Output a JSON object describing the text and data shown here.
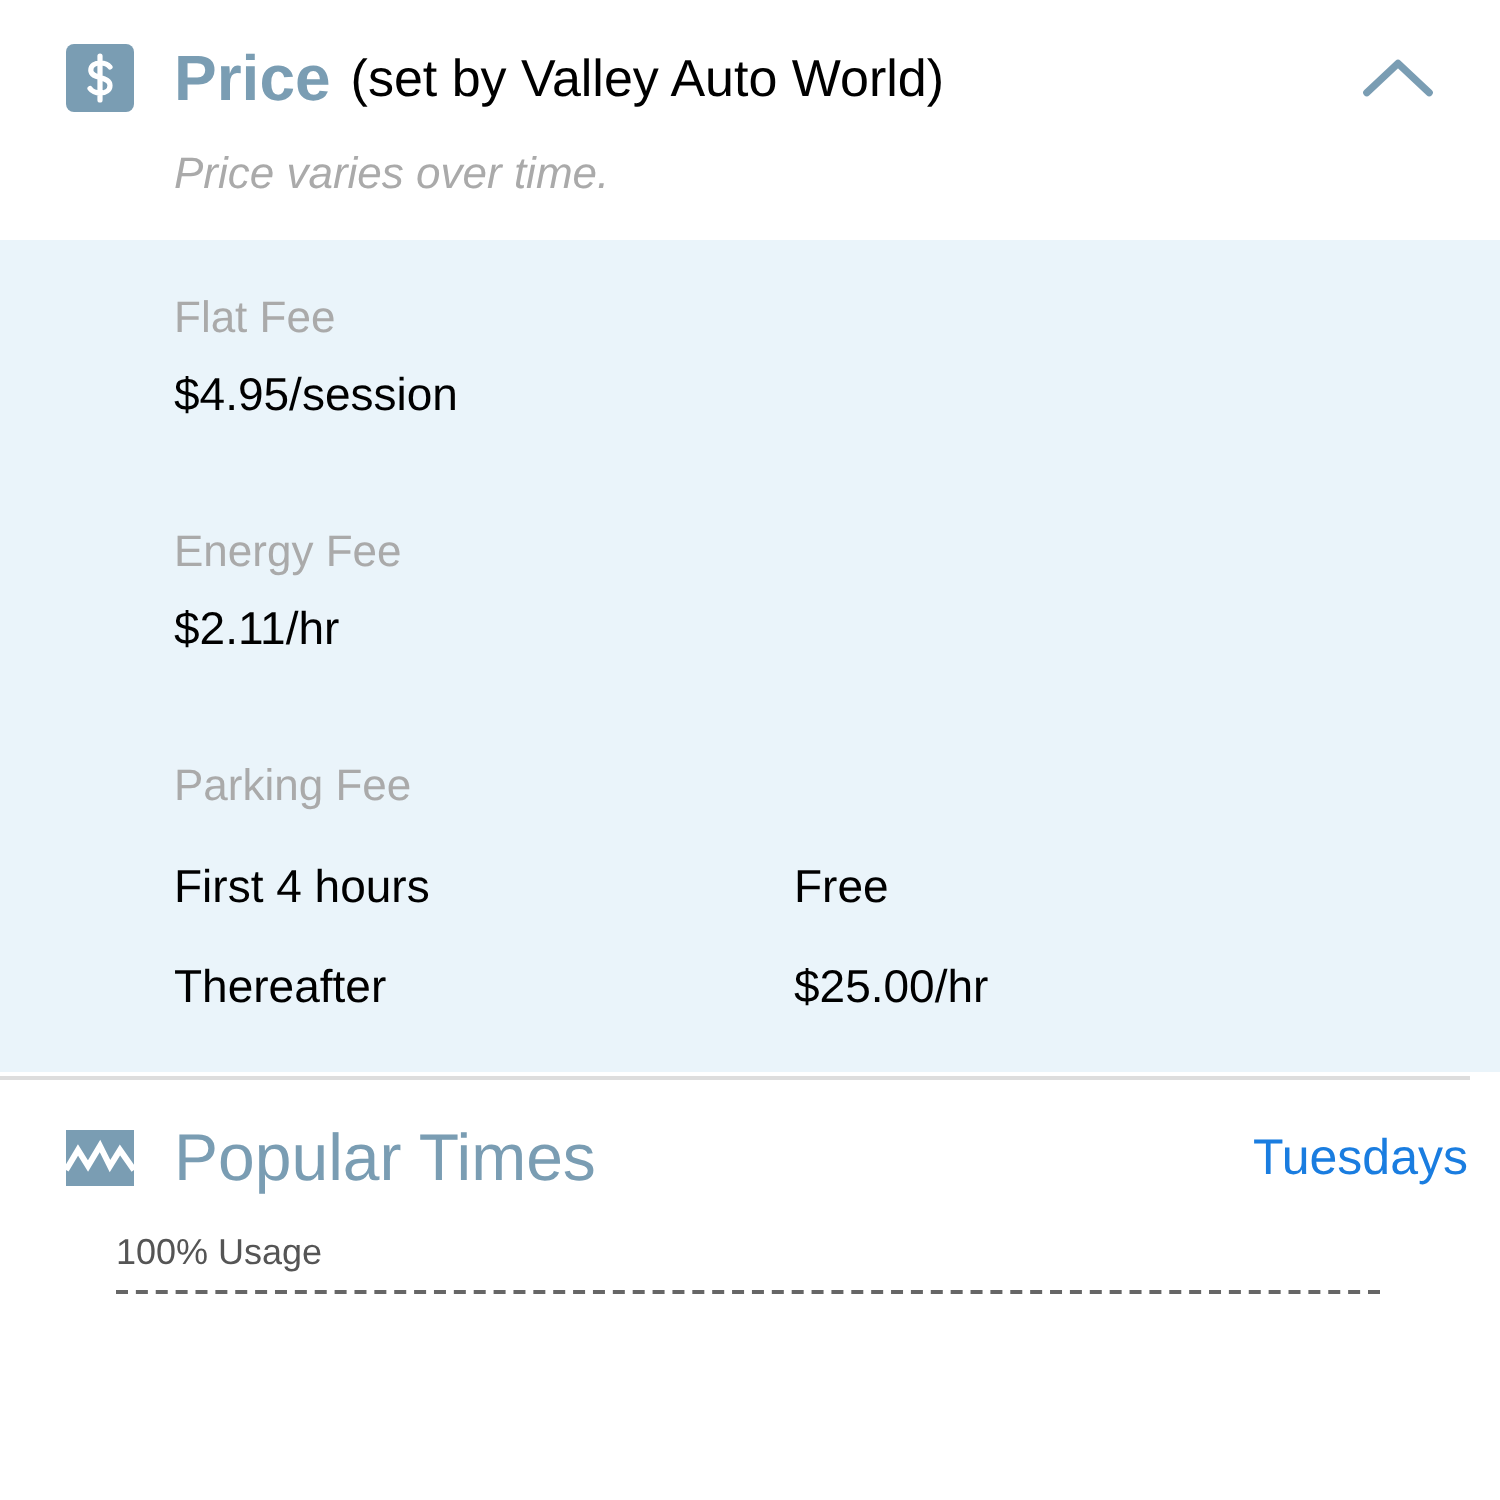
{
  "price": {
    "title": "Price",
    "setter": "(set by Valley Auto World)",
    "expanded": true,
    "note": "Price varies over time.",
    "fees": [
      {
        "kind": "single",
        "label": "Flat Fee",
        "value": "$4.95/session"
      },
      {
        "kind": "single",
        "label": "Energy Fee",
        "value": "$2.11/hr"
      },
      {
        "kind": "table",
        "label": "Parking Fee",
        "rows": [
          {
            "term": "First 4 hours",
            "value": "Free"
          },
          {
            "term": "Thereafter",
            "value": "$25.00/hr"
          }
        ]
      }
    ]
  },
  "popular_times": {
    "title": "Popular Times",
    "day": "Tuesdays",
    "usage_label": "100% Usage"
  }
}
